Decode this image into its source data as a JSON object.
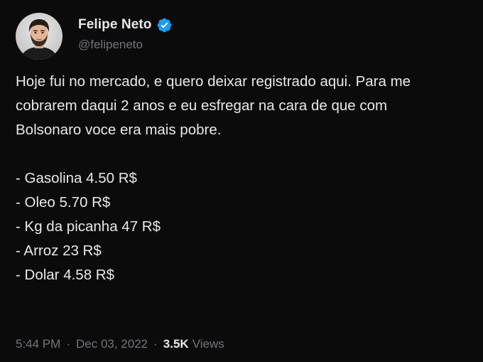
{
  "tweet": {
    "author": {
      "display_name": "Felipe Neto",
      "handle": "@felipeneto",
      "verified_icon": "verified-badge-icon",
      "verified_color": "#1d9bf0"
    },
    "lines": [
      "Hoje fui no mercado, e quero deixar registrado aqui. Para me",
      "cobrarem daqui 2 anos e eu esfregar na cara de que com",
      "Bolsonaro voce era mais pobre."
    ],
    "list_items": [
      "- Gasolina 4.50 R$",
      "- Oleo 5.70 R$",
      "- Kg da picanha 47 R$",
      "- Arroz 23 R$",
      "- Dolar 4.58 R$"
    ],
    "meta": {
      "time": "5:44 PM",
      "separator": "·",
      "date": "Dec 03, 2022",
      "views_count": "3.5K",
      "views_label": "Views"
    }
  },
  "colors": {
    "background": "#0b0b0c",
    "text_primary": "#e7e9ea",
    "text_secondary": "#71767b"
  }
}
